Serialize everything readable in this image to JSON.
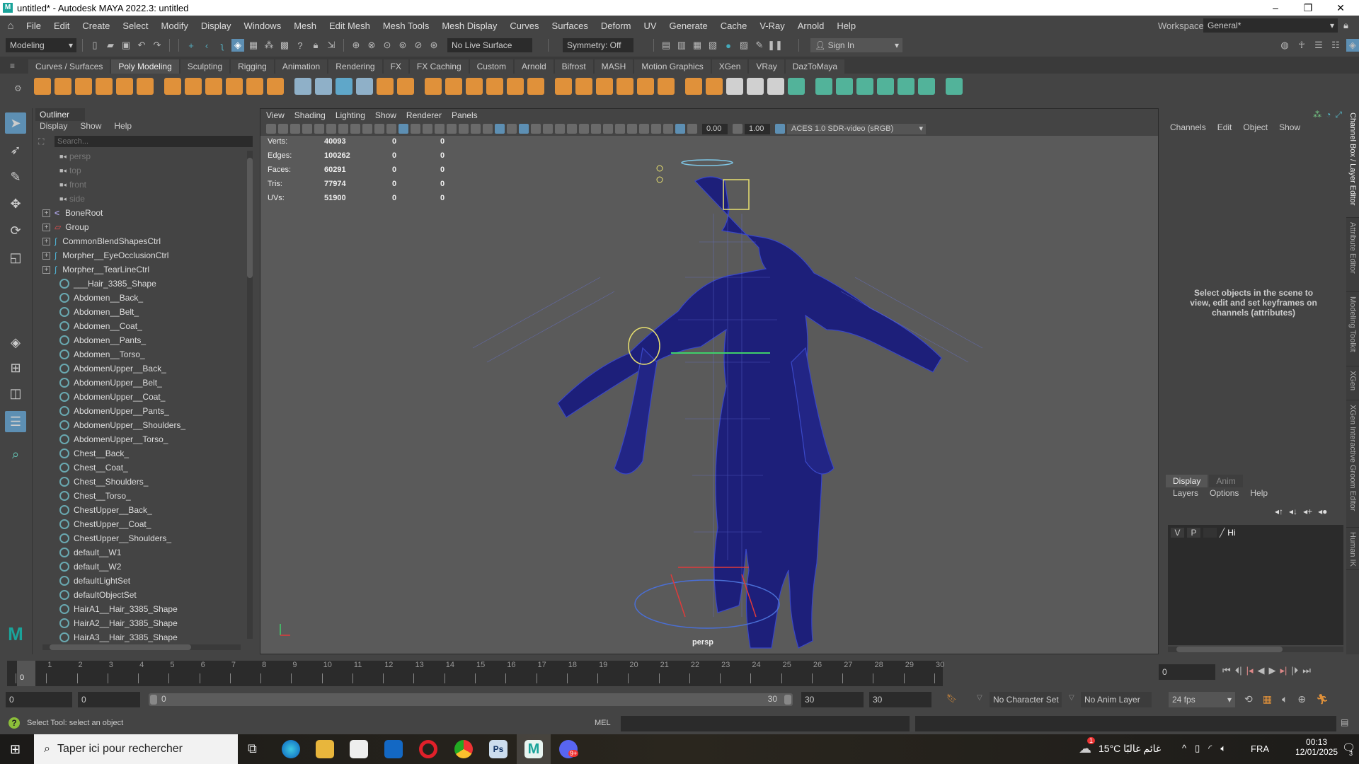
{
  "window": {
    "title": "untitled* - Autodesk MAYA 2022.3: untitled",
    "logo": "M",
    "minimize": "–",
    "maximize": "❐",
    "close": "✕"
  },
  "menu": [
    "File",
    "Edit",
    "Create",
    "Select",
    "Modify",
    "Display",
    "Windows",
    "Mesh",
    "Edit Mesh",
    "Mesh Tools",
    "Mesh Display",
    "Curves",
    "Surfaces",
    "Deform",
    "UV",
    "Generate",
    "Cache",
    "V-Ray",
    "Arnold",
    "Help"
  ],
  "workspace": {
    "label": "Workspace:",
    "value": "General*"
  },
  "statusline": {
    "mode": "Modeling",
    "live_surface": "No Live Surface",
    "symmetry": "Symmetry: Off",
    "sign_in": "Sign In"
  },
  "shelf_tabs": [
    "Curves / Surfaces",
    "Poly Modeling",
    "Sculpting",
    "Rigging",
    "Animation",
    "Rendering",
    "FX",
    "FX Caching",
    "Custom",
    "Arnold",
    "Bifrost",
    "MASH",
    "Motion Graphics",
    "XGen",
    "VRay",
    "DazToMaya"
  ],
  "shelf_active": 1,
  "shelf_icons": [
    {
      "name": "poly-sphere",
      "color": "#e0913a"
    },
    {
      "name": "poly-cube",
      "color": "#e0913a"
    },
    {
      "name": "poly-cylinder",
      "color": "#e0913a"
    },
    {
      "name": "poly-cone",
      "color": "#e0913a"
    },
    {
      "name": "poly-torus",
      "color": "#e0913a"
    },
    {
      "name": "poly-plane",
      "color": "#e0913a"
    },
    {
      "name": "poly-disc",
      "color": "#e0913a"
    },
    {
      "name": "platonic",
      "color": "#e0913a"
    },
    {
      "name": "super-shape",
      "color": "#e0913a"
    },
    {
      "name": "sweep-mesh",
      "color": "#e0913a"
    },
    {
      "name": "type",
      "color": "#e0913a"
    },
    {
      "name": "svg",
      "color": "#e0913a"
    },
    {
      "name": "uv-editor",
      "color": "#8fb0c8"
    },
    {
      "name": "measure",
      "color": "#8fb0c8"
    },
    {
      "name": "plane-center",
      "color": "#5fa7c9"
    },
    {
      "name": "bullet",
      "color": "#8fb0c8"
    },
    {
      "name": "combine",
      "color": "#e0913a"
    },
    {
      "name": "separate",
      "color": "#e0913a"
    },
    {
      "name": "extract",
      "color": "#e0913a"
    },
    {
      "name": "booleans",
      "color": "#e0913a"
    },
    {
      "name": "smooth",
      "color": "#e0913a"
    },
    {
      "name": "reduce",
      "color": "#e0913a"
    },
    {
      "name": "remesh",
      "color": "#e0913a"
    },
    {
      "name": "retopo",
      "color": "#e0913a"
    },
    {
      "name": "mirror",
      "color": "#e0913a"
    },
    {
      "name": "extrude",
      "color": "#e0913a"
    },
    {
      "name": "bridge",
      "color": "#e0913a"
    },
    {
      "name": "bevel",
      "color": "#e0913a"
    },
    {
      "name": "fill-hole",
      "color": "#e0913a"
    },
    {
      "name": "append",
      "color": "#e0913a"
    },
    {
      "name": "wedge",
      "color": "#e0913a"
    },
    {
      "name": "poke",
      "color": "#e0913a"
    },
    {
      "name": "multi-cut",
      "color": "#d0d0d0"
    },
    {
      "name": "edge-loop",
      "color": "#d0d0d0"
    },
    {
      "name": "knife",
      "color": "#d0d0d0"
    },
    {
      "name": "planar-uv",
      "color": "#52b39a"
    },
    {
      "name": "cylindrical-uv",
      "color": "#52b39a"
    },
    {
      "name": "spherical-uv",
      "color": "#52b39a"
    },
    {
      "name": "auto-uv",
      "color": "#52b39a"
    },
    {
      "name": "unfold",
      "color": "#52b39a"
    },
    {
      "name": "layout",
      "color": "#52b39a"
    },
    {
      "name": "cut-uv",
      "color": "#52b39a"
    },
    {
      "name": "sew-uv",
      "color": "#52b39a"
    }
  ],
  "outliner": {
    "title": "Outliner",
    "menu": [
      "Display",
      "Show",
      "Help"
    ],
    "search_placeholder": "Search...",
    "items": [
      {
        "label": "persp",
        "type": "camera"
      },
      {
        "label": "top",
        "type": "camera"
      },
      {
        "label": "front",
        "type": "camera"
      },
      {
        "label": "side",
        "type": "camera"
      },
      {
        "label": "BoneRoot",
        "type": "joint",
        "expand": "+"
      },
      {
        "label": "Group",
        "type": "group",
        "expand": "+"
      },
      {
        "label": "CommonBlendShapesCtrl",
        "type": "curve",
        "expand": "+"
      },
      {
        "label": "Morpher__EyeOcclusionCtrl",
        "type": "curve",
        "expand": "+"
      },
      {
        "label": "Morpher__TearLineCtrl",
        "type": "curve",
        "expand": "+"
      },
      {
        "label": "___Hair_3385_Shape",
        "type": "set"
      },
      {
        "label": "Abdomen__Back_",
        "type": "set"
      },
      {
        "label": "Abdomen__Belt_",
        "type": "set"
      },
      {
        "label": "Abdomen__Coat_",
        "type": "set"
      },
      {
        "label": "Abdomen__Pants_",
        "type": "set"
      },
      {
        "label": "Abdomen__Torso_",
        "type": "set"
      },
      {
        "label": "AbdomenUpper__Back_",
        "type": "set"
      },
      {
        "label": "AbdomenUpper__Belt_",
        "type": "set"
      },
      {
        "label": "AbdomenUpper__Coat_",
        "type": "set"
      },
      {
        "label": "AbdomenUpper__Pants_",
        "type": "set"
      },
      {
        "label": "AbdomenUpper__Shoulders_",
        "type": "set"
      },
      {
        "label": "AbdomenUpper__Torso_",
        "type": "set"
      },
      {
        "label": "Chest__Back_",
        "type": "set"
      },
      {
        "label": "Chest__Coat_",
        "type": "set"
      },
      {
        "label": "Chest__Shoulders_",
        "type": "set"
      },
      {
        "label": "Chest__Torso_",
        "type": "set"
      },
      {
        "label": "ChestUpper__Back_",
        "type": "set"
      },
      {
        "label": "ChestUpper__Coat_",
        "type": "set"
      },
      {
        "label": "ChestUpper__Shoulders_",
        "type": "set"
      },
      {
        "label": "default__W1",
        "type": "set"
      },
      {
        "label": "default__W2",
        "type": "set"
      },
      {
        "label": "defaultLightSet",
        "type": "set"
      },
      {
        "label": "defaultObjectSet",
        "type": "set"
      },
      {
        "label": "HairA1__Hair_3385_Shape",
        "type": "set"
      },
      {
        "label": "HairA2__Hair_3385_Shape",
        "type": "set"
      },
      {
        "label": "HairA3__Hair_3385_Shape",
        "type": "set"
      }
    ]
  },
  "viewport": {
    "menu": [
      "View",
      "Shading",
      "Lighting",
      "Show",
      "Renderer",
      "Panels"
    ],
    "exposure": "0.00",
    "gamma": "1.00",
    "color_space": "ACES 1.0 SDR-video (sRGB)",
    "camera": "persp",
    "stats": [
      {
        "label": "Verts:",
        "v": "40093",
        "a": "0",
        "b": "0"
      },
      {
        "label": "Edges:",
        "v": "100262",
        "a": "0",
        "b": "0"
      },
      {
        "label": "Faces:",
        "v": "60291",
        "a": "0",
        "b": "0"
      },
      {
        "label": "Tris:",
        "v": "77974",
        "a": "0",
        "b": "0"
      },
      {
        "label": "UVs:",
        "v": "51900",
        "a": "0",
        "b": "0"
      }
    ]
  },
  "channelbox": {
    "menu": [
      "Channels",
      "Edit",
      "Object",
      "Show"
    ],
    "hint": "Select objects in the scene to view, edit and set keyframes on channels (attributes)"
  },
  "layers": {
    "tabs": [
      "Display",
      "Anim"
    ],
    "menu": [
      "Layers",
      "Options",
      "Help"
    ],
    "row": {
      "v": "V",
      "p": "P",
      "name": "Hi"
    }
  },
  "side_tabs": [
    "Channel Box / Layer Editor",
    "Attribute Editor",
    "Modeling Toolkit",
    "XGen",
    "XGen Interactive Groom Editor",
    "Human IK"
  ],
  "timeline": {
    "ticks": [
      0,
      1,
      2,
      3,
      4,
      5,
      6,
      7,
      8,
      9,
      10,
      11,
      12,
      13,
      14,
      15,
      16,
      17,
      18,
      19,
      20,
      21,
      22,
      23,
      24,
      25,
      26,
      27,
      28,
      29,
      30
    ],
    "current": "0",
    "current_field": "0"
  },
  "range": {
    "start": "0",
    "anim_start": "0",
    "slider_start": "0",
    "slider_end": "30",
    "end": "30",
    "anim_end": "30",
    "character_set": "No Character Set",
    "anim_layer": "No Anim Layer",
    "fps": "24 fps"
  },
  "command": {
    "status": "Select Tool: select an object",
    "lang": "MEL"
  },
  "taskbar": {
    "search": "Taper ici pour rechercher",
    "weather": "15°C  غائم غالبًا",
    "lang": "FRA",
    "time": "00:13",
    "date": "12/01/2025",
    "notifications": "3",
    "weather_badge": "1",
    "discord_badge": "9+"
  }
}
